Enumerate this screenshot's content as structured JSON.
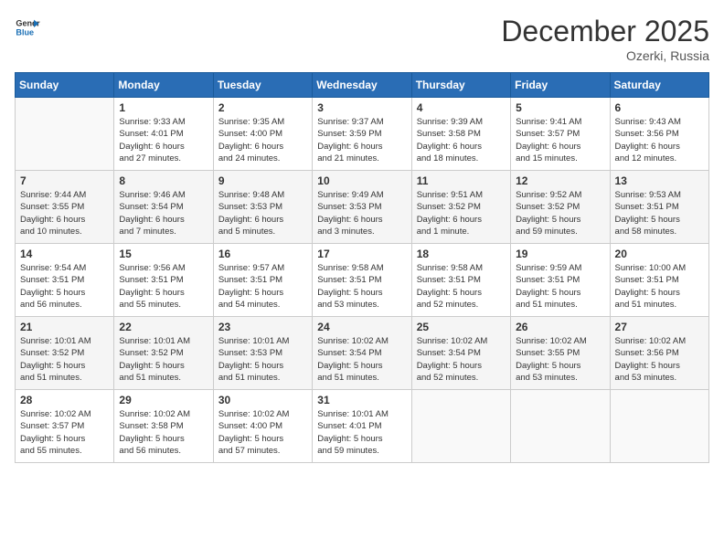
{
  "header": {
    "logo_general": "General",
    "logo_blue": "Blue",
    "month_year": "December 2025",
    "location": "Ozerki, Russia"
  },
  "days_of_week": [
    "Sunday",
    "Monday",
    "Tuesday",
    "Wednesday",
    "Thursday",
    "Friday",
    "Saturday"
  ],
  "weeks": [
    [
      {
        "day": "",
        "info": ""
      },
      {
        "day": "1",
        "info": "Sunrise: 9:33 AM\nSunset: 4:01 PM\nDaylight: 6 hours\nand 27 minutes."
      },
      {
        "day": "2",
        "info": "Sunrise: 9:35 AM\nSunset: 4:00 PM\nDaylight: 6 hours\nand 24 minutes."
      },
      {
        "day": "3",
        "info": "Sunrise: 9:37 AM\nSunset: 3:59 PM\nDaylight: 6 hours\nand 21 minutes."
      },
      {
        "day": "4",
        "info": "Sunrise: 9:39 AM\nSunset: 3:58 PM\nDaylight: 6 hours\nand 18 minutes."
      },
      {
        "day": "5",
        "info": "Sunrise: 9:41 AM\nSunset: 3:57 PM\nDaylight: 6 hours\nand 15 minutes."
      },
      {
        "day": "6",
        "info": "Sunrise: 9:43 AM\nSunset: 3:56 PM\nDaylight: 6 hours\nand 12 minutes."
      }
    ],
    [
      {
        "day": "7",
        "info": "Sunrise: 9:44 AM\nSunset: 3:55 PM\nDaylight: 6 hours\nand 10 minutes."
      },
      {
        "day": "8",
        "info": "Sunrise: 9:46 AM\nSunset: 3:54 PM\nDaylight: 6 hours\nand 7 minutes."
      },
      {
        "day": "9",
        "info": "Sunrise: 9:48 AM\nSunset: 3:53 PM\nDaylight: 6 hours\nand 5 minutes."
      },
      {
        "day": "10",
        "info": "Sunrise: 9:49 AM\nSunset: 3:53 PM\nDaylight: 6 hours\nand 3 minutes."
      },
      {
        "day": "11",
        "info": "Sunrise: 9:51 AM\nSunset: 3:52 PM\nDaylight: 6 hours\nand 1 minute."
      },
      {
        "day": "12",
        "info": "Sunrise: 9:52 AM\nSunset: 3:52 PM\nDaylight: 5 hours\nand 59 minutes."
      },
      {
        "day": "13",
        "info": "Sunrise: 9:53 AM\nSunset: 3:51 PM\nDaylight: 5 hours\nand 58 minutes."
      }
    ],
    [
      {
        "day": "14",
        "info": "Sunrise: 9:54 AM\nSunset: 3:51 PM\nDaylight: 5 hours\nand 56 minutes."
      },
      {
        "day": "15",
        "info": "Sunrise: 9:56 AM\nSunset: 3:51 PM\nDaylight: 5 hours\nand 55 minutes."
      },
      {
        "day": "16",
        "info": "Sunrise: 9:57 AM\nSunset: 3:51 PM\nDaylight: 5 hours\nand 54 minutes."
      },
      {
        "day": "17",
        "info": "Sunrise: 9:58 AM\nSunset: 3:51 PM\nDaylight: 5 hours\nand 53 minutes."
      },
      {
        "day": "18",
        "info": "Sunrise: 9:58 AM\nSunset: 3:51 PM\nDaylight: 5 hours\nand 52 minutes."
      },
      {
        "day": "19",
        "info": "Sunrise: 9:59 AM\nSunset: 3:51 PM\nDaylight: 5 hours\nand 51 minutes."
      },
      {
        "day": "20",
        "info": "Sunrise: 10:00 AM\nSunset: 3:51 PM\nDaylight: 5 hours\nand 51 minutes."
      }
    ],
    [
      {
        "day": "21",
        "info": "Sunrise: 10:01 AM\nSunset: 3:52 PM\nDaylight: 5 hours\nand 51 minutes."
      },
      {
        "day": "22",
        "info": "Sunrise: 10:01 AM\nSunset: 3:52 PM\nDaylight: 5 hours\nand 51 minutes."
      },
      {
        "day": "23",
        "info": "Sunrise: 10:01 AM\nSunset: 3:53 PM\nDaylight: 5 hours\nand 51 minutes."
      },
      {
        "day": "24",
        "info": "Sunrise: 10:02 AM\nSunset: 3:54 PM\nDaylight: 5 hours\nand 51 minutes."
      },
      {
        "day": "25",
        "info": "Sunrise: 10:02 AM\nSunset: 3:54 PM\nDaylight: 5 hours\nand 52 minutes."
      },
      {
        "day": "26",
        "info": "Sunrise: 10:02 AM\nSunset: 3:55 PM\nDaylight: 5 hours\nand 53 minutes."
      },
      {
        "day": "27",
        "info": "Sunrise: 10:02 AM\nSunset: 3:56 PM\nDaylight: 5 hours\nand 53 minutes."
      }
    ],
    [
      {
        "day": "28",
        "info": "Sunrise: 10:02 AM\nSunset: 3:57 PM\nDaylight: 5 hours\nand 55 minutes."
      },
      {
        "day": "29",
        "info": "Sunrise: 10:02 AM\nSunset: 3:58 PM\nDaylight: 5 hours\nand 56 minutes."
      },
      {
        "day": "30",
        "info": "Sunrise: 10:02 AM\nSunset: 4:00 PM\nDaylight: 5 hours\nand 57 minutes."
      },
      {
        "day": "31",
        "info": "Sunrise: 10:01 AM\nSunset: 4:01 PM\nDaylight: 5 hours\nand 59 minutes."
      },
      {
        "day": "",
        "info": ""
      },
      {
        "day": "",
        "info": ""
      },
      {
        "day": "",
        "info": ""
      }
    ]
  ]
}
